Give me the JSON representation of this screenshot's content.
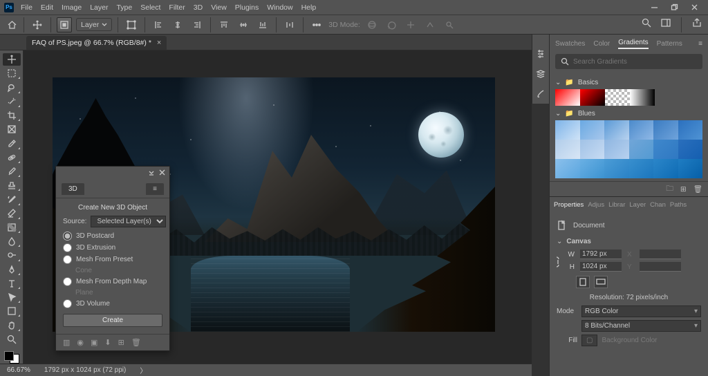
{
  "menu": [
    "File",
    "Edit",
    "Image",
    "Layer",
    "Type",
    "Select",
    "Filter",
    "3D",
    "View",
    "Plugins",
    "Window",
    "Help"
  ],
  "optbar": {
    "layer_label": "Layer",
    "mode_label": "3D Mode:"
  },
  "doc_tab": "FAQ of PS.jpeg @ 66.7% (RGB/8#) *",
  "panel3d": {
    "tab": "3D",
    "title": "Create New 3D Object",
    "source_label": "Source:",
    "source_value": "Selected Layer(s)",
    "opts": [
      "3D Postcard",
      "3D Extrusion",
      "Mesh From Preset",
      "Mesh From Depth Map",
      "3D Volume"
    ],
    "preset_dim": "Cone",
    "depth_dim": "Plane",
    "create": "Create"
  },
  "right": {
    "tabs1": [
      "Swatches",
      "Color",
      "Gradients",
      "Patterns"
    ],
    "search_placeholder": "Search Gradients",
    "basics_label": "Basics",
    "blues_label": "Blues",
    "basics_grads": [
      "linear-gradient(135deg,#ff0000,#ffffff)",
      "linear-gradient(135deg,#ff0000,#000000)",
      "repeating-conic-gradient(#bbb 0 25%, #fff 0 50%) 0/8px 8px",
      "linear-gradient(90deg,#ffffff,#000000)"
    ],
    "blues_grads": [
      "linear-gradient(135deg,#7db3e8,#cfe3f7)",
      "linear-gradient(135deg,#6aa9e2,#a7c7ec)",
      "linear-gradient(135deg,#5a99d6,#b8d2ef)",
      "linear-gradient(135deg,#4b8acb,#8fb8e6)",
      "linear-gradient(135deg,#3a7bc1,#6fa3db)",
      "linear-gradient(135deg,#2b70be,#4f93d4)",
      "linear-gradient(135deg,#b1cdea,#d8e6f5)",
      "linear-gradient(135deg,#a1c2e6,#c7dbf3)",
      "linear-gradient(135deg,#8fb6e1,#b7d1ef)",
      "linear-gradient(135deg,#71a6d8,#539ad2)",
      "linear-gradient(135deg,#3f88cc,#2f78c2)",
      "linear-gradient(135deg,#2a6fbd,#155fb0)",
      "linear-gradient(135deg,#8bc0ec,#5aa6df)",
      "linear-gradient(135deg,#6ab0e4,#3c93d1)",
      "linear-gradient(135deg,#4b9cd6,#2a82c6)",
      "linear-gradient(135deg,#388fce,#1b76bd)",
      "linear-gradient(135deg,#2b86c9,#0e6bb4)",
      "linear-gradient(135deg,#1f7dc3,#065fa7)"
    ],
    "tabs2": [
      "Properties",
      "Adjustments",
      "Libraries",
      "Layers",
      "Channels",
      "Paths"
    ],
    "doc_label": "Document",
    "canvas_label": "Canvas",
    "W": "1792 px",
    "H": "1024 px",
    "res_prefix": "Resolution: ",
    "res_value": "72 pixels/inch",
    "mode_label": "Mode",
    "mode_value": "RGB Color",
    "depth_value": "8 Bits/Channel",
    "fill_label": "Fill",
    "fill_value": "Background Color"
  },
  "status": {
    "zoom": "66.67%",
    "info": "1792 px x 1024 px (72 ppi)"
  }
}
